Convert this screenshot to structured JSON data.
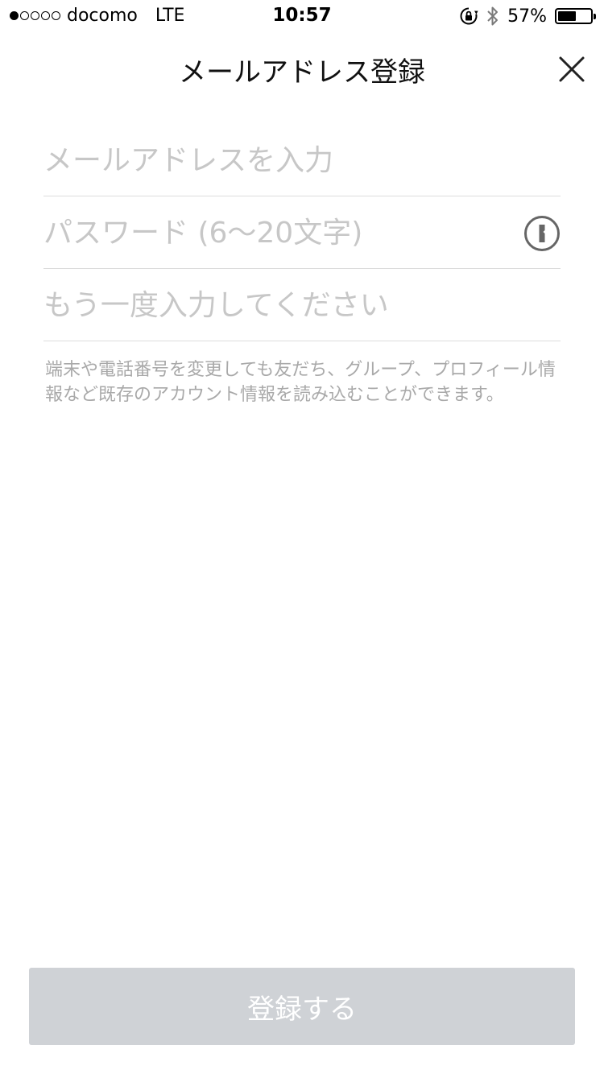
{
  "status_bar": {
    "carrier": "docomo",
    "network": "LTE",
    "time": "10:57",
    "battery_percent": "57%",
    "battery_level": 0.57,
    "signal_strength": 1,
    "icons": [
      "orientation-lock-icon",
      "bluetooth-icon",
      "battery-icon"
    ]
  },
  "nav": {
    "title": "メールアドレス登録",
    "close_icon": "close-icon"
  },
  "form": {
    "email_placeholder": "メールアドレスを入力",
    "password_placeholder": "パスワード (6〜20文字)",
    "password_confirm_placeholder": "もう一度入力してください",
    "password_manager_icon": "password-manager-key-icon"
  },
  "note": "端末や電話番号を変更しても友だち、グループ、プロフィール情報など既存のアカウント情報を読み込むことができます。",
  "submit_label": "登録する",
  "colors": {
    "placeholder": "#c7c7c7",
    "divider": "#dcdcdc",
    "note_text": "#a9a9a9",
    "button_disabled": "#cfd2d6"
  }
}
